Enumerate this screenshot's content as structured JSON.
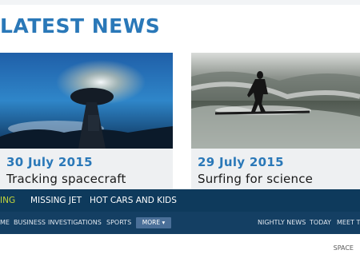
{
  "section_title": "LATEST NEWS",
  "cards": [
    {
      "date": "30 July 2015",
      "title": "Tracking spacecraft"
    },
    {
      "date": "29 July 2015",
      "title": "Surfing for science"
    }
  ],
  "trending": [
    "ING",
    "MISSING JET",
    "HOT CARS AND KIDS"
  ],
  "nav": {
    "left": [
      "ME",
      "BUSINESS",
      "INVESTIGATIONS",
      "SPORTS"
    ],
    "more_label": "MORE ▾",
    "right": [
      "NIGHTLY NEWS",
      "TODAY",
      "MEET T"
    ]
  },
  "footer_label": "SPACE",
  "colors": {
    "accent": "#2a78b8",
    "trending_bar": "#0e3a5c",
    "nav_bar": "#143f63",
    "highlight": "#c4d63b"
  }
}
